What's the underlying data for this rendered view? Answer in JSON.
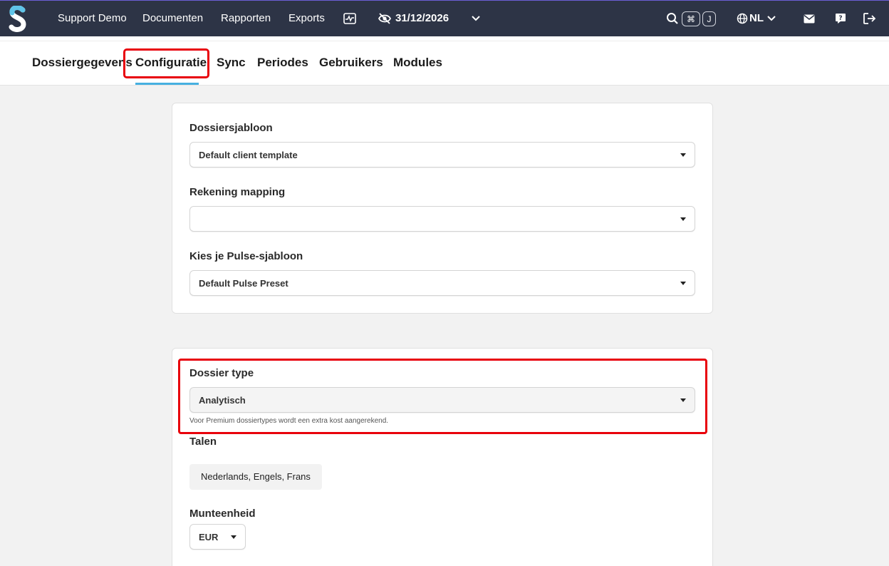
{
  "topbar": {
    "nav": [
      "Support Demo",
      "Documenten",
      "Rapporten",
      "Exports"
    ],
    "date": "31/12/2026",
    "shortcut_keys": [
      "⌘",
      "J"
    ],
    "language": "NL",
    "icons": [
      "activity-icon",
      "eye-off-icon",
      "chevron-down-icon",
      "search-icon",
      "globe-icon",
      "mail-icon",
      "help-icon",
      "logout-icon"
    ]
  },
  "tabs": [
    "Dossiergegevens",
    "Configuratie",
    "Sync",
    "Periodes",
    "Gebruikers",
    "Modules"
  ],
  "active_tab": "Configuratie",
  "templates_card": {
    "dossier_template_label": "Dossiersjabloon",
    "dossier_template_value": "Default client template",
    "account_mapping_label": "Rekening mapping",
    "account_mapping_value": "",
    "pulse_template_label": "Kies je Pulse-sjabloon",
    "pulse_template_value": "Default Pulse Preset"
  },
  "settings_card": {
    "dossier_type_label": "Dossier type",
    "dossier_type_value": "Analytisch",
    "dossier_type_help": "Voor Premium dossiertypes wordt een extra kost aangerekend.",
    "languages_label": "Talen",
    "languages_value": "Nederlands, Engels, Frans",
    "currency_label": "Munteenheid",
    "currency_value": "EUR"
  },
  "colors": {
    "topbar_bg": "#2d3446",
    "highlight_red": "#e8000b",
    "tab_underline": "#46b0e0"
  }
}
